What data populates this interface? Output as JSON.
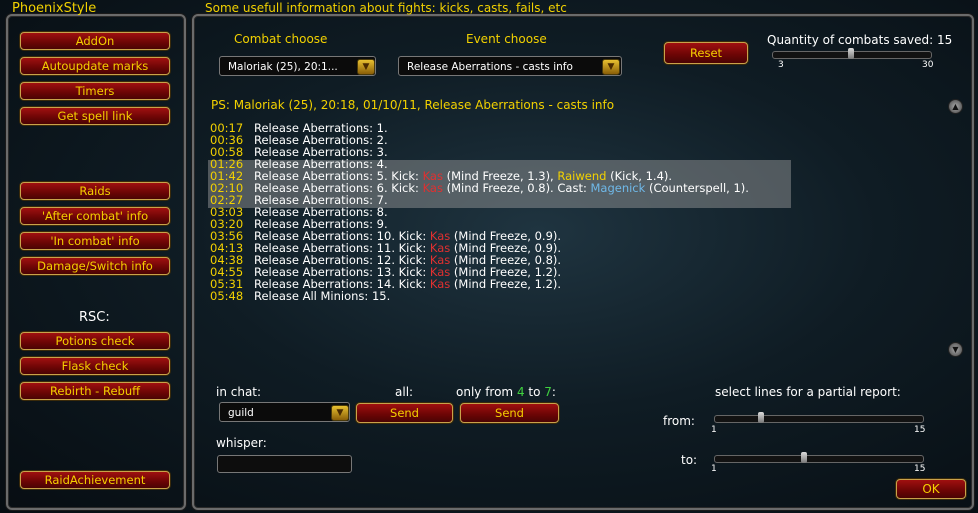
{
  "app_title": "PhoenixStyle",
  "header_subtitle": "Some usefull information about fights: kicks, casts, fails, etc",
  "sidebar": {
    "group1": [
      "AddOn",
      "Autoupdate marks",
      "Timers",
      "Get spell link"
    ],
    "group2": [
      "Raids",
      "'After combat' info",
      "'In combat' info",
      "Damage/Switch info"
    ],
    "rsc_label": "RSC:",
    "group3": [
      "Potions check",
      "Flask check",
      "Rebirth - Rebuff"
    ],
    "raid_achievement": "RaidAchievement"
  },
  "controls": {
    "combat_choose_label": "Combat choose",
    "combat_choose_value": "Maloriak (25), 20:1...",
    "event_choose_label": "Event choose",
    "event_choose_value": "Release Aberrations - casts info",
    "reset_label": "Reset",
    "quantity_label": "Quantity of combats saved: 15",
    "quantity_min": "3",
    "quantity_max": "30",
    "quantity_value": 15
  },
  "report_header": "PS: Maloriak (25), 20:18, 01/10/11, Release Aberrations - casts info",
  "log": [
    {
      "time": "00:17",
      "text": "Release Aberrations: 1."
    },
    {
      "time": "00:36",
      "text": "Release Aberrations: 2."
    },
    {
      "time": "00:58",
      "text": "Release Aberrations: 3."
    },
    {
      "time": "01:26",
      "text": "Release Aberrations: 4."
    },
    {
      "time": "01:42",
      "text": "Release Aberrations: 5. Kick: ",
      "p1": "Kas",
      "p1c": "red",
      "m1": " (Mind Freeze, 1.3), ",
      "p2": "Raiwend",
      "p2c": "yel",
      "m2": " (Kick, 1.4)."
    },
    {
      "time": "02:10",
      "text": "Release Aberrations: 6. Kick: ",
      "p1": "Kas",
      "p1c": "red",
      "m1": " (Mind Freeze, 0.8). Cast: ",
      "p2": "Magenick",
      "p2c": "blue",
      "m2": " (Counterspell, 1)."
    },
    {
      "time": "02:27",
      "text": "Release Aberrations: 7."
    },
    {
      "time": "03:03",
      "text": "Release Aberrations: 8."
    },
    {
      "time": "03:20",
      "text": "Release Aberrations: 9."
    },
    {
      "time": "03:56",
      "text": "Release Aberrations: 10. Kick: ",
      "p1": "Kas",
      "p1c": "red",
      "m1": " (Mind Freeze, 0.9)."
    },
    {
      "time": "04:13",
      "text": "Release Aberrations: 11. Kick: ",
      "p1": "Kas",
      "p1c": "red",
      "m1": " (Mind Freeze, 0.9)."
    },
    {
      "time": "04:38",
      "text": "Release Aberrations: 12. Kick: ",
      "p1": "Kas",
      "p1c": "red",
      "m1": " (Mind Freeze, 0.8)."
    },
    {
      "time": "04:55",
      "text": "Release Aberrations: 13. Kick: ",
      "p1": "Kas",
      "p1c": "red",
      "m1": " (Mind Freeze, 1.2)."
    },
    {
      "time": "05:31",
      "text": "Release Aberrations: 14. Kick: ",
      "p1": "Kas",
      "p1c": "red",
      "m1": " (Mind Freeze, 1.2)."
    },
    {
      "time": "05:48",
      "text": "Release All Minions: 15."
    }
  ],
  "bottom": {
    "in_chat_label": "in chat:",
    "chat_value": "guild",
    "all_label": "all:",
    "send_label": "Send",
    "only_from_prefix": "only from ",
    "only_from_a": "4",
    "only_from_mid": " to ",
    "only_from_b": "7",
    "only_from_suffix": ":",
    "whisper_label": "whisper:",
    "whisper_value": "",
    "select_lines_label": "select lines for a partial report:",
    "from_label": "from:",
    "to_label": "to:",
    "range_min": "1",
    "range_max": "15",
    "from_value": 4,
    "to_value": 7,
    "ok_label": "OK"
  }
}
